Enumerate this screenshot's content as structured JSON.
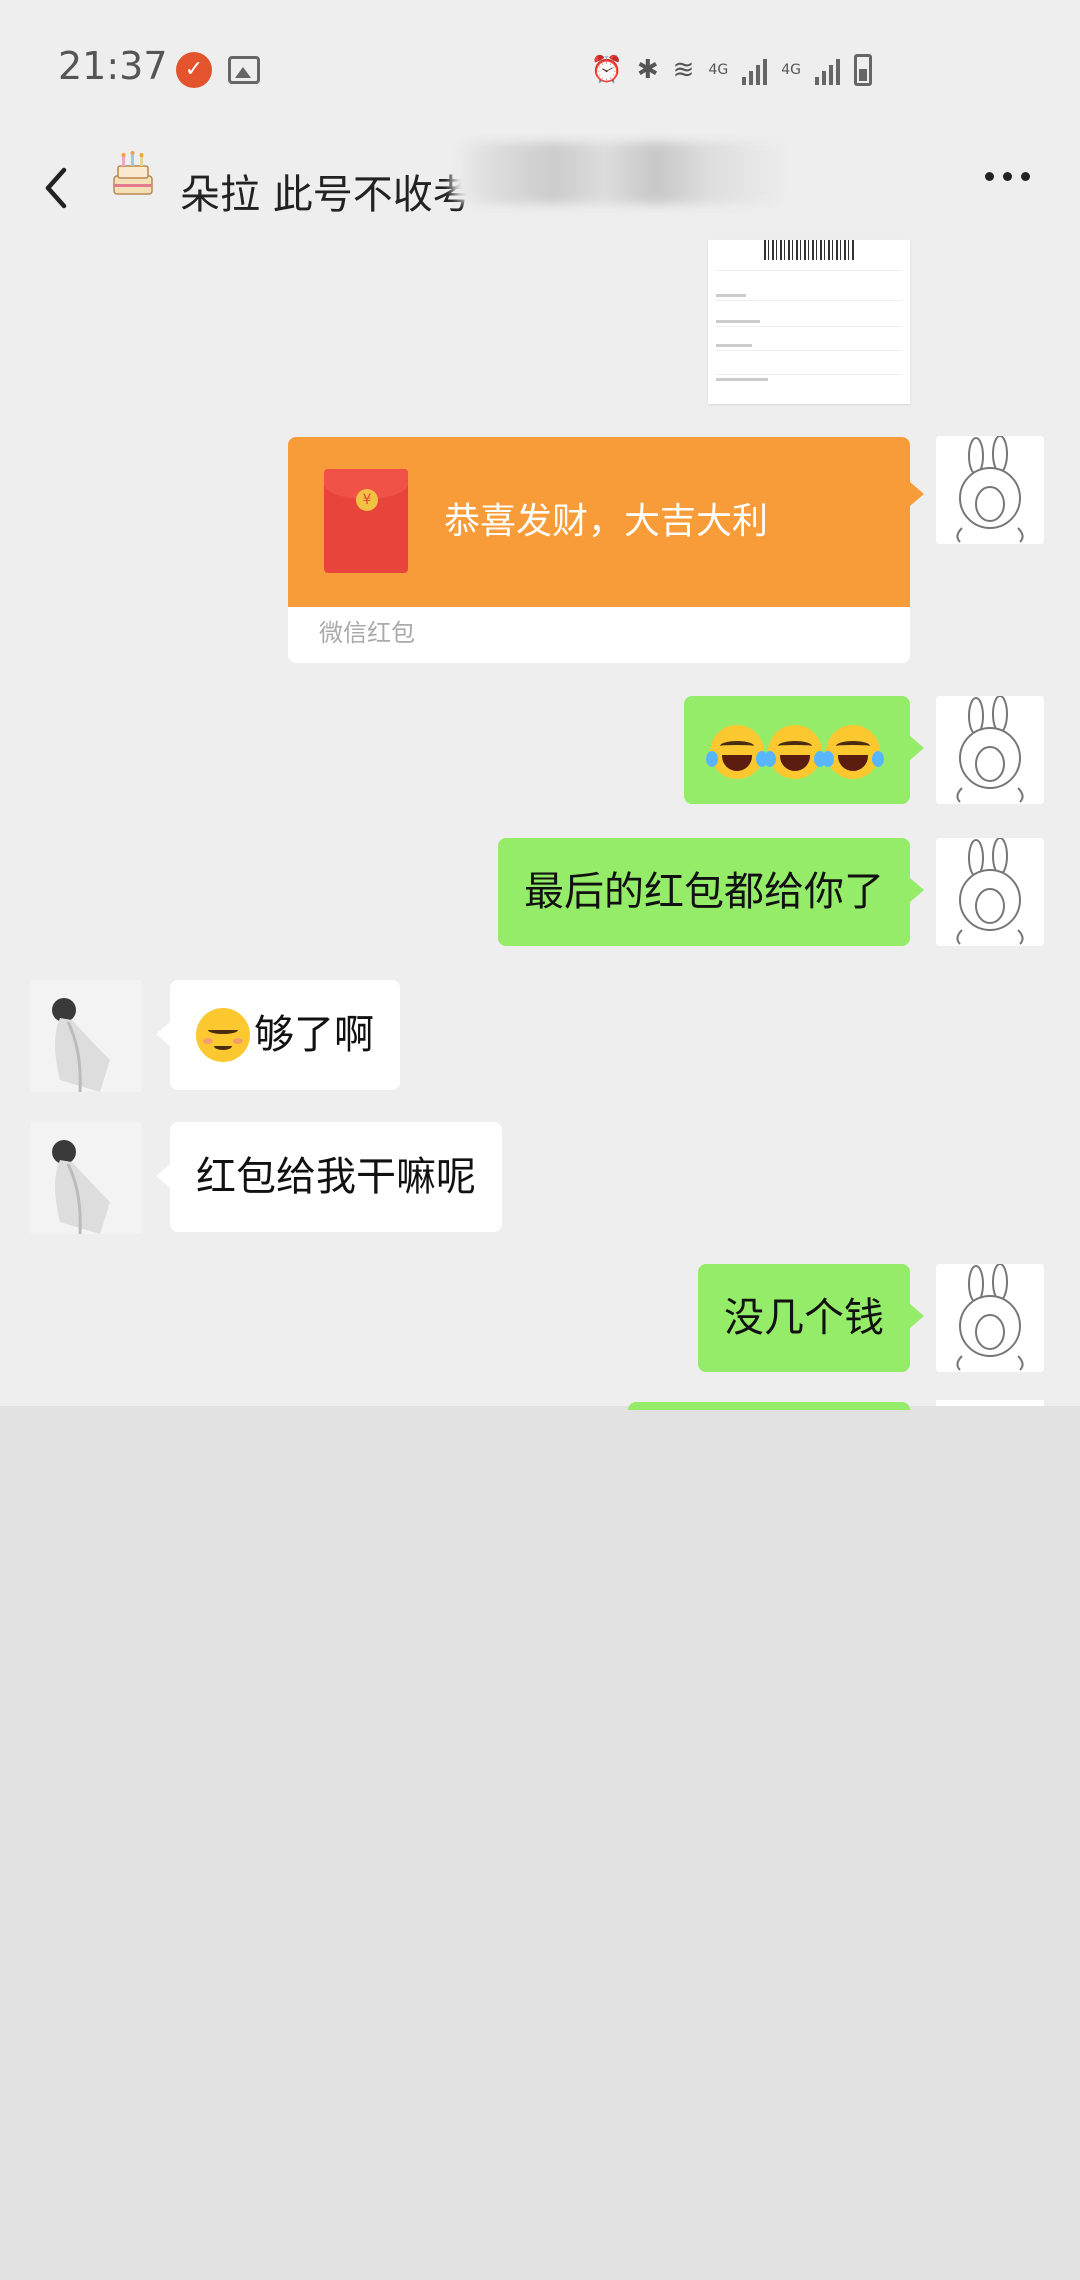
{
  "status_bar": {
    "time": "21:37",
    "network_1": "4G",
    "network_2": "4G",
    "icons": [
      "notification-badge",
      "image",
      "alarm",
      "bluetooth",
      "wifi",
      "signal",
      "signal",
      "battery-charging"
    ]
  },
  "header": {
    "title_visible": "朵拉 此号不收",
    "title_partial": "考",
    "back_icon": "chevron-left",
    "avatar_icon": "cake-emoji",
    "more_icon": "more-dots"
  },
  "messages": [
    {
      "side": "me",
      "type": "image",
      "content": "screenshot"
    },
    {
      "side": "me",
      "type": "red_packet",
      "text": "恭喜发财，大吉大利",
      "footer": "微信红包"
    },
    {
      "side": "me",
      "type": "emoji",
      "content": "😂😂😂"
    },
    {
      "side": "me",
      "type": "text",
      "text": "最后的红包都给你了"
    },
    {
      "side": "other",
      "type": "text",
      "emoji": "☺",
      "text": "够了啊"
    },
    {
      "side": "other",
      "type": "text",
      "text": "红包给我干嘛呢"
    },
    {
      "side": "me",
      "type": "text",
      "text": "没几个钱"
    }
  ],
  "colors": {
    "chat_bg": "#eeeeee",
    "my_bubble": "#95ec69",
    "their_bubble": "#ffffff",
    "red_packet": "#f89c3a",
    "lower_bg": "#e2e2e2"
  }
}
